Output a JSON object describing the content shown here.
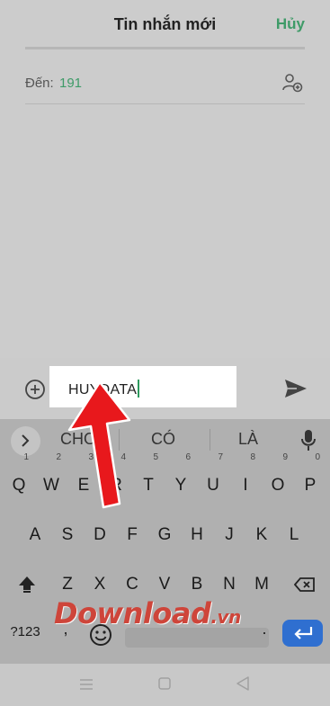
{
  "header": {
    "title": "Tin nhắn mới",
    "cancel_label": "Hủy"
  },
  "recipient": {
    "label": "Đến:",
    "value": "191"
  },
  "compose": {
    "text": "HUYDATA"
  },
  "keyboard": {
    "suggestions": [
      "CHO",
      "CÓ",
      "LÀ"
    ],
    "row1": [
      {
        "k": "Q",
        "n": "1"
      },
      {
        "k": "W",
        "n": "2"
      },
      {
        "k": "E",
        "n": "3"
      },
      {
        "k": "R",
        "n": "4"
      },
      {
        "k": "T",
        "n": "5"
      },
      {
        "k": "Y",
        "n": "6"
      },
      {
        "k": "U",
        "n": "7"
      },
      {
        "k": "I",
        "n": "8"
      },
      {
        "k": "O",
        "n": "9"
      },
      {
        "k": "P",
        "n": "0"
      }
    ],
    "row2": [
      "A",
      "S",
      "D",
      "F",
      "G",
      "H",
      "J",
      "K",
      "L"
    ],
    "row3": [
      "Z",
      "X",
      "C",
      "V",
      "B",
      "N",
      "M"
    ],
    "symbols_label": "?123",
    "period_label": ".",
    "comma_label": ","
  },
  "watermark": {
    "main": "Download",
    "tld": ".vn"
  },
  "colors": {
    "accent": "#3f9b68",
    "enter": "#2f6fd0",
    "arrow": "#e8181c"
  }
}
